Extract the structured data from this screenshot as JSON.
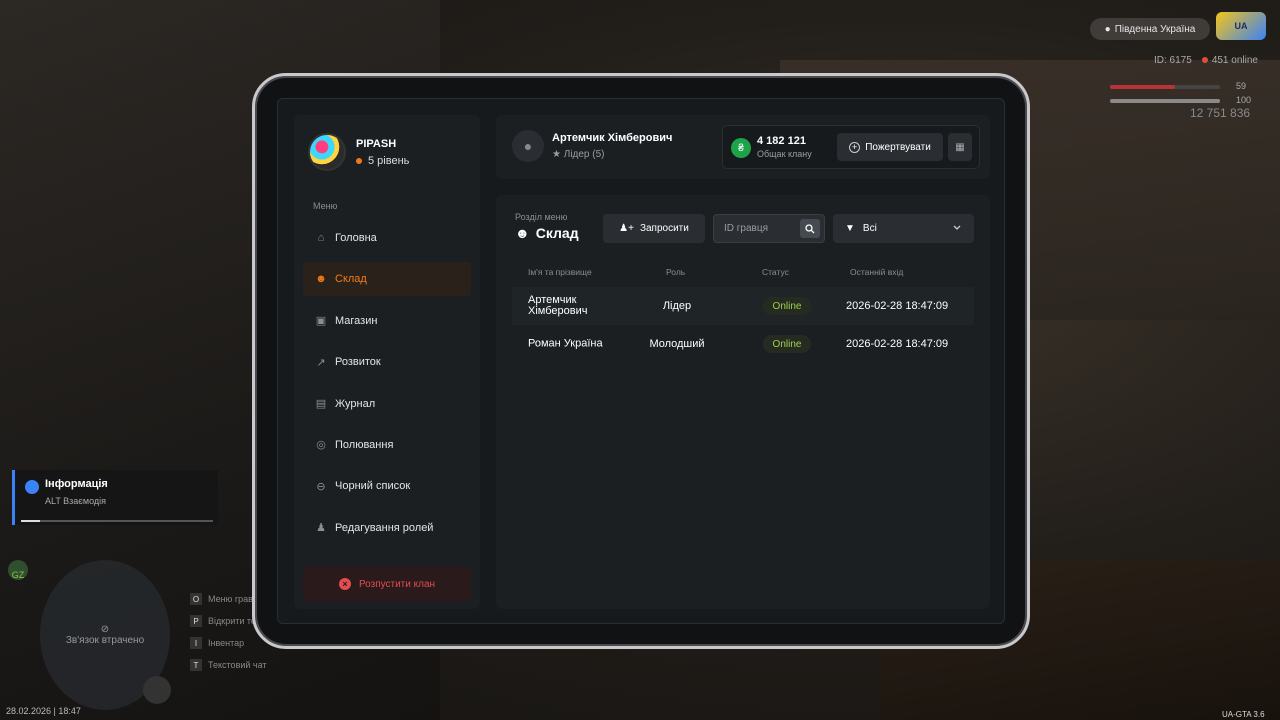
{
  "hud": {
    "region": "Південна Україна",
    "logo_text": "PIPASH",
    "player_id": "ID: 6175",
    "online": "451 online",
    "health_value": "59",
    "armor_value": "100",
    "health_level": 0.59,
    "armor_level": 1.0,
    "money": "12 751 836",
    "info_title": "Інформація",
    "info_subtitle": "ALT Взаємодія",
    "info_progress": 0.1,
    "gz": "GZ",
    "minimap_text": "Зв'язок втрачено",
    "hotkeys": [
      {
        "key": "O",
        "label": "Меню гравця"
      },
      {
        "key": "P",
        "label": "Відкрити телефон"
      },
      {
        "key": "I",
        "label": "Інвентар"
      },
      {
        "key": "T",
        "label": "Текстовий чат"
      }
    ],
    "date": "28.02.2026 | 18:47",
    "version": "UA-GTA 3.6"
  },
  "profile": {
    "name": "PIPASH",
    "level": "5 рівень"
  },
  "menu": {
    "caption": "Меню",
    "items": [
      {
        "label": "Головна",
        "icon": "home-icon"
      },
      {
        "label": "Склад",
        "icon": "people-icon"
      },
      {
        "label": "Магазин",
        "icon": "shop-icon"
      },
      {
        "label": "Розвиток",
        "icon": "chart-icon"
      },
      {
        "label": "Журнал",
        "icon": "book-icon"
      },
      {
        "label": "Полювання",
        "icon": "target-icon"
      },
      {
        "label": "Чорний список",
        "icon": "block-icon"
      },
      {
        "label": "Редагування ролей",
        "icon": "user-edit-icon"
      }
    ],
    "disband": "Розпустити клан"
  },
  "header": {
    "leader_name": "Артемчик Хімберович",
    "leader_role": "Лідер (5)",
    "bank_sum": "4 182 121",
    "bank_label": "Общак клану",
    "donate": "Пожертвувати"
  },
  "section": {
    "caption": "Розділ меню",
    "title": "Склад",
    "invite": "Запросити",
    "search_placeholder": "ID гравця",
    "filter_value": "Всі"
  },
  "table": {
    "headers": [
      "Ім'я та прізвище",
      "Роль",
      "Статус",
      "Останній вхід"
    ],
    "rows": [
      {
        "name": "Артемчик Хімберович",
        "role": "Лідер",
        "status": "Online",
        "last": "2026-02-28 18:47:09"
      },
      {
        "name": "Роман Україна",
        "role": "Молодший",
        "status": "Online",
        "last": "2026-02-28 18:47:09"
      }
    ]
  },
  "colors": {
    "accent": "#f07a1a",
    "danger": "#e24d4d",
    "online": "#9bd14a",
    "bank": "#1fa34a"
  }
}
